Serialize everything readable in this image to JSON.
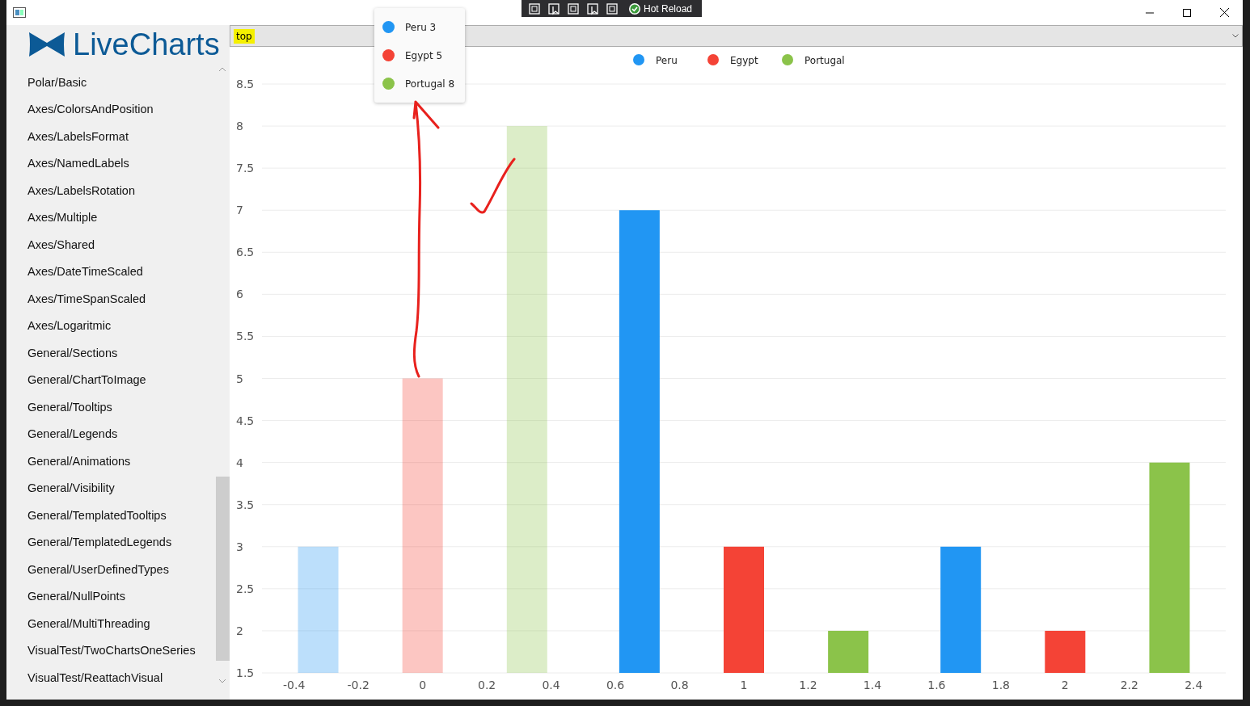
{
  "debug_toolbar": {
    "label": "Hot Reload"
  },
  "logo": {
    "text": "LiveCharts"
  },
  "sidebar": {
    "items": [
      "Polar/Basic",
      "Axes/ColorsAndPosition",
      "Axes/LabelsFormat",
      "Axes/NamedLabels",
      "Axes/LabelsRotation",
      "Axes/Multiple",
      "Axes/Shared",
      "Axes/DateTimeScaled",
      "Axes/TimeSpanScaled",
      "Axes/Logaritmic",
      "General/Sections",
      "General/ChartToImage",
      "General/Tooltips",
      "General/Legends",
      "General/Animations",
      "General/Visibility",
      "General/TemplatedTooltips",
      "General/TemplatedLegends",
      "General/UserDefinedTypes",
      "General/NullPoints",
      "General/MultiThreading",
      "VisualTest/TwoChartsOneSeries",
      "VisualTest/ReattachVisual"
    ]
  },
  "position_select": {
    "value": "top",
    "highlighted": true
  },
  "chart": {
    "tooltip": [
      {
        "label": "Peru 3",
        "color": "#2196f3"
      },
      {
        "label": "Egypt 5",
        "color": "#f44336"
      },
      {
        "label": "Portugal 8",
        "color": "#8bc34a"
      }
    ],
    "categories": [
      {
        "faded": true
      },
      {
        "faded": false
      },
      {
        "faded": false
      }
    ],
    "chart_data": {
      "type": "bar",
      "grid": true,
      "legend": "top",
      "x": [
        0,
        1,
        2
      ],
      "series": [
        {
          "name": "Peru",
          "color": "#2196f3",
          "values": [
            3,
            7,
            3
          ]
        },
        {
          "name": "Egypt",
          "color": "#f44336",
          "values": [
            5,
            3,
            2
          ]
        },
        {
          "name": "Portugal",
          "color": "#8bc34a",
          "values": [
            8,
            2,
            4
          ]
        }
      ],
      "xlim": [
        -0.5,
        2.5
      ],
      "ylim": [
        1.5,
        8.5
      ],
      "xticks": [
        -0.4,
        -0.2,
        0,
        0.2,
        0.4,
        0.6,
        0.8,
        1,
        1.2,
        1.4,
        1.6,
        1.8,
        2,
        2.2,
        2.4
      ],
      "yticks": [
        1.5,
        2,
        2.5,
        3,
        3.5,
        4,
        4.5,
        5,
        5.5,
        6,
        6.5,
        7,
        7.5,
        8,
        8.5
      ]
    }
  },
  "annotations": [
    {
      "kind": "arrow"
    },
    {
      "kind": "check"
    }
  ]
}
